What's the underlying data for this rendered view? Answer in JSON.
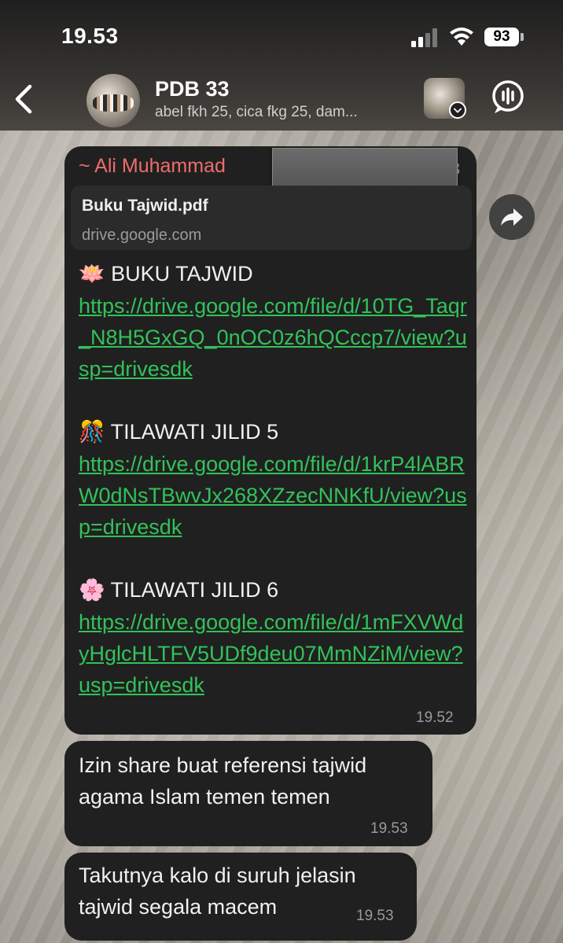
{
  "status_bar": {
    "time": "19.53",
    "battery": "93"
  },
  "header": {
    "title": "PDB 33",
    "subtitle": "abel fkh 25, cica fkg 25, dam..."
  },
  "messages": [
    {
      "sender": "~ Ali Muhammad",
      "sender_tail": "3",
      "link_preview": {
        "title": "Buku Tajwid.pdf",
        "domain": "drive.google.com"
      },
      "sections": [
        {
          "emoji": "🪷",
          "heading": "BUKU TAJWID",
          "link": "https://drive.google.com/file/d/10TG_Taqr_N8H5GxGQ_0nOC0z6hQCccp7/view?usp=drivesdk"
        },
        {
          "emoji": "🎊",
          "heading": "TILAWATI JILID 5",
          "link": "https://drive.google.com/file/d/1krP4lABRW0dNsTBwvJx268XZzecNNKfU/view?usp=drivesdk"
        },
        {
          "emoji": "🌸",
          "heading": "TILAWATI JILID 6",
          "link": "https://drive.google.com/file/d/1mFXVWdyHglcHLTFV5UDf9deu07MmNZiM/view?usp=drivesdk"
        }
      ],
      "time": "19.52"
    },
    {
      "text_line1": "Izin share buat referensi tajwid",
      "text_line2": "agama Islam temen temen",
      "time": "19.53"
    },
    {
      "text_line1": "Takutnya kalo di suruh jelasin",
      "text_line2": "tajwid segala macem",
      "time": "19.53"
    }
  ]
}
